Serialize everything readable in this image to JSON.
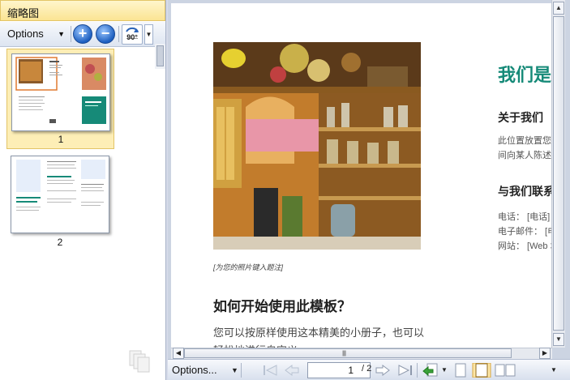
{
  "thumbnail_panel": {
    "title": "缩略图",
    "options_label": "Options",
    "rotate_label": "90°",
    "pages": [
      {
        "label": "1"
      },
      {
        "label": "2"
      }
    ]
  },
  "document": {
    "photo_caption": "[为您的照片键入题注]",
    "howto_heading": "如何开始使用此模板？",
    "howto_body": "您可以按原样使用这本精美的小册子，也可以轻松地进行自定义",
    "right_title": "我们是",
    "about_heading": "关于我们",
    "about_line1": "此位置放置您的",
    "about_line2": "间向某人陈述您",
    "contact_heading": "与我们联系",
    "contact_phone": "电话： [电话]",
    "contact_email": "电子邮件： [电",
    "contact_web": "网站： [Web 地"
  },
  "navigation": {
    "options_label": "Options...",
    "current_page": "1",
    "total_pages": "/ 2"
  },
  "colors": {
    "accent_teal": "#168a78",
    "selected_thumb_bg": "#fdeeb6",
    "title_bar_yellow": "#fbe493"
  }
}
